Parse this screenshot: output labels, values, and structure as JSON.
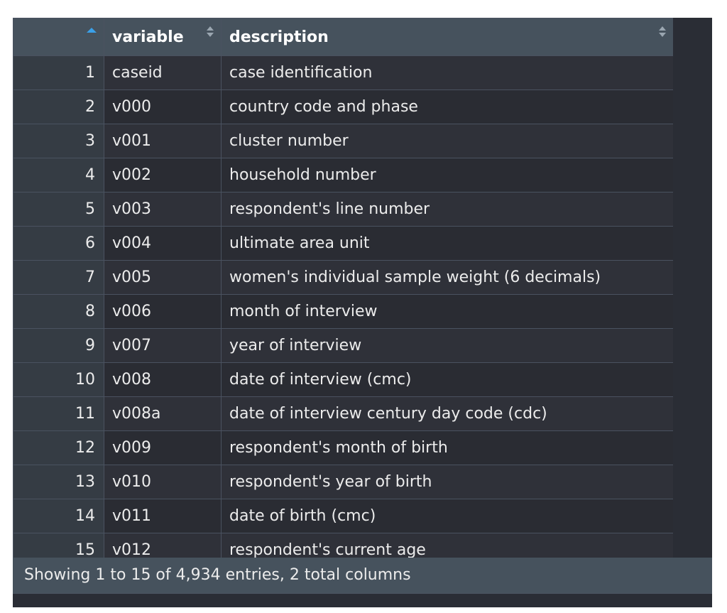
{
  "table": {
    "columns": [
      "variable",
      "description"
    ],
    "rows": [
      {
        "index": "1",
        "variable": "caseid",
        "description": "case identification"
      },
      {
        "index": "2",
        "variable": "v000",
        "description": "country code and phase"
      },
      {
        "index": "3",
        "variable": "v001",
        "description": "cluster number"
      },
      {
        "index": "4",
        "variable": "v002",
        "description": "household number"
      },
      {
        "index": "5",
        "variable": "v003",
        "description": "respondent's line number"
      },
      {
        "index": "6",
        "variable": "v004",
        "description": "ultimate area unit"
      },
      {
        "index": "7",
        "variable": "v005",
        "description": "women's individual sample weight (6 decimals)"
      },
      {
        "index": "8",
        "variable": "v006",
        "description": "month of interview"
      },
      {
        "index": "9",
        "variable": "v007",
        "description": "year of interview"
      },
      {
        "index": "10",
        "variable": "v008",
        "description": "date of interview (cmc)"
      },
      {
        "index": "11",
        "variable": "v008a",
        "description": "date of interview century day code (cdc)"
      },
      {
        "index": "12",
        "variable": "v009",
        "description": "respondent's month of birth"
      },
      {
        "index": "13",
        "variable": "v010",
        "description": "respondent's year of birth"
      },
      {
        "index": "14",
        "variable": "v011",
        "description": "date of birth (cmc)"
      },
      {
        "index": "15",
        "variable": "v012",
        "description": "respondent's current age"
      }
    ]
  },
  "footer": {
    "status": "Showing 1 to 15 of 4,934 entries, 2 total columns"
  },
  "colors": {
    "header_bg": "#46525d",
    "body_bg": "#2a2d35",
    "sort_active": "#3aa0e8"
  },
  "icons": {
    "sort_active": "sort-ascending-icon",
    "sort_both": "sort-both-icon"
  }
}
